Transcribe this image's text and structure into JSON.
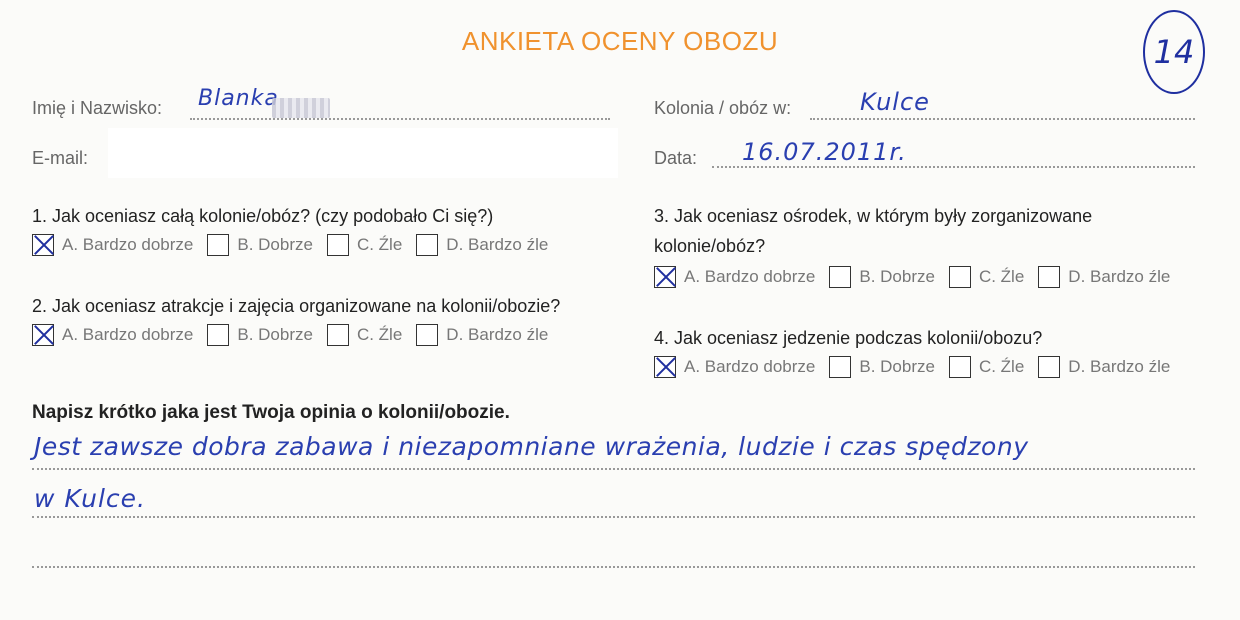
{
  "form": {
    "title": "ANKIETA OCENY OBOZU",
    "number": "14",
    "name_label": "Imię i Nazwisko:",
    "name_value": "Blanka",
    "email_label": "E-mail:",
    "camp_label": "Kolonia / obóz w:",
    "camp_value": "Kulce",
    "date_label": "Data:",
    "date_value": "16.07.2011r."
  },
  "questions": [
    {
      "text": "1. Jak oceniasz całą kolonie/obóz? (czy podobało Ci się?)",
      "options": [
        "A. Bardzo dobrze",
        "B. Dobrze",
        "C. Źle",
        "D. Bardzo źle"
      ],
      "selected": 0
    },
    {
      "text": "2.  Jak oceniasz atrakcje i zajęcia organizowane na kolonii/obozie?",
      "options": [
        "A. Bardzo dobrze",
        "B. Dobrze",
        "C. Źle",
        "D. Bardzo źle"
      ],
      "selected": 0
    },
    {
      "text_line1": "3. Jak oceniasz ośrodek, w którym były zorganizowane",
      "text_line2": "kolonie/obóz?",
      "options": [
        "A. Bardzo dobrze",
        "B. Dobrze",
        "C. Źle",
        "D. Bardzo źle"
      ],
      "selected": 0
    },
    {
      "text": "4.  Jak oceniasz jedzenie podczas kolonii/obozu?",
      "options": [
        "A. Bardzo dobrze",
        "B. Dobrze",
        "C. Źle",
        "D. Bardzo źle"
      ],
      "selected": 0
    }
  ],
  "opinion": {
    "title": "Napisz krótko jaka jest Twoja opinia o kolonii/obozie.",
    "line1": "Jest zawsze dobra zabawa i niezapomniane wrażenia, ludzie i czas spędzony",
    "line2": "w Kulce."
  }
}
